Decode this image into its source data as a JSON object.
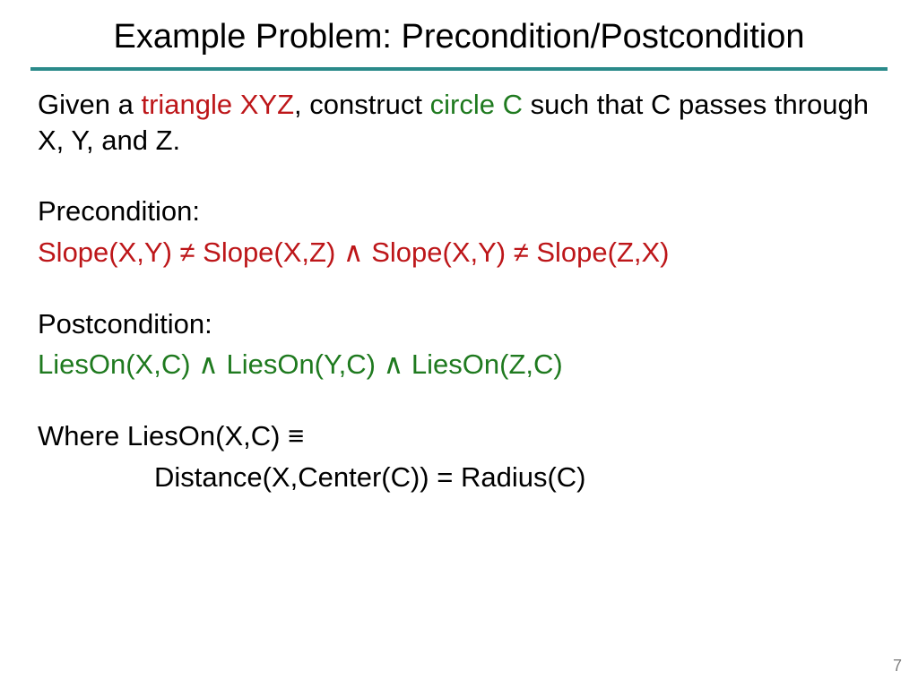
{
  "title": "Example Problem: Precondition/Postcondition",
  "intro": {
    "pre": "Given a ",
    "triangle": "triangle XYZ",
    "mid": ", construct ",
    "circle": "circle C",
    "post": " such that C passes through X, Y, and Z."
  },
  "precondition_label": "Precondition:",
  "precondition_expr": "Slope(X,Y) ≠ Slope(X,Z)  ∧ Slope(X,Y) ≠ Slope(Z,X)",
  "postcondition_label": "Postcondition:",
  "postcondition_expr": "LiesOn(X,C) ∧ LiesOn(Y,C) ∧ LiesOn(Z,C)",
  "where_line": "Where LiesOn(X,C) ≡",
  "def_line": "Distance(X,Center(C)) = Radius(C)",
  "page_number": "7"
}
